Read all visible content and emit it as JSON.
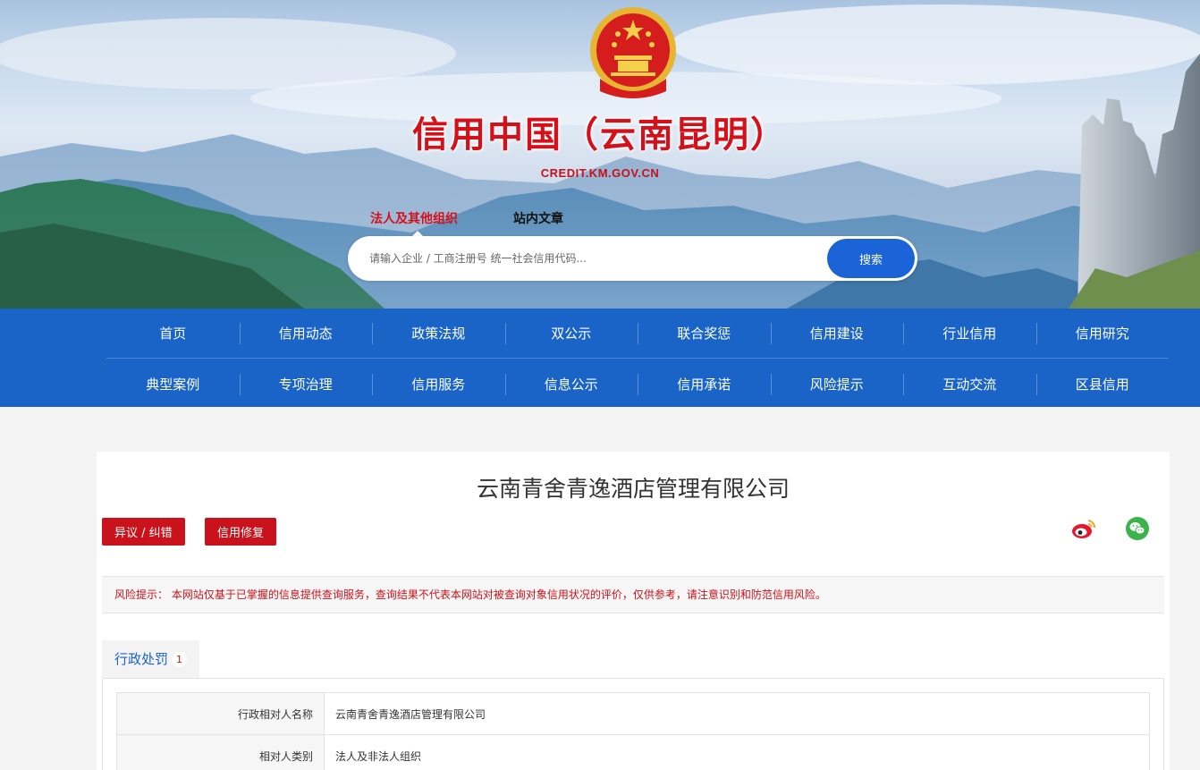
{
  "banner": {
    "site_title": "信用中国（云南昆明）",
    "site_domain": "CREDIT.KM.GOV.CN",
    "emblem_icon": "national-emblem-icon",
    "search_tabs": [
      {
        "label": "法人及其他组织",
        "active": true
      },
      {
        "label": "站内文章",
        "active": false
      }
    ],
    "search": {
      "placeholder": "请输入企业 / 工商注册号 统一社会信用代码...",
      "value": "",
      "button_label": "搜索"
    }
  },
  "nav": {
    "row1": [
      "首页",
      "信用动态",
      "政策法规",
      "双公示",
      "联合奖惩",
      "信用建设",
      "行业信用",
      "信用研究"
    ],
    "row2": [
      "典型案例",
      "专项治理",
      "信用服务",
      "信息公示",
      "信用承诺",
      "风险提示",
      "互动交流",
      "区县信用"
    ]
  },
  "main": {
    "company_name": "云南青舍青逸酒店管理有限公司",
    "objection_button": "异议 / 纠错",
    "repair_button": "信用修复",
    "share_icons": [
      "weibo-icon",
      "wechat-icon"
    ],
    "risk_notice": "风险提示：  本网站仅基于已掌握的信息提供查询服务，查询结果不代表本网站对被查询对象信用状况的评价，仅供参考，请注意识别和防范信用风险。",
    "tab": {
      "label": "行政处罚",
      "count": "1"
    },
    "table": [
      {
        "key": "行政相对人名称",
        "value": "云南青舍青逸酒店管理有限公司"
      },
      {
        "key": "相对人类别",
        "value": "法人及非法人组织"
      }
    ]
  },
  "colors": {
    "nav_blue": "#1a64c8",
    "brand_red": "#d4101b",
    "button_red": "#c9121b",
    "search_button_blue": "#1a64d8"
  }
}
